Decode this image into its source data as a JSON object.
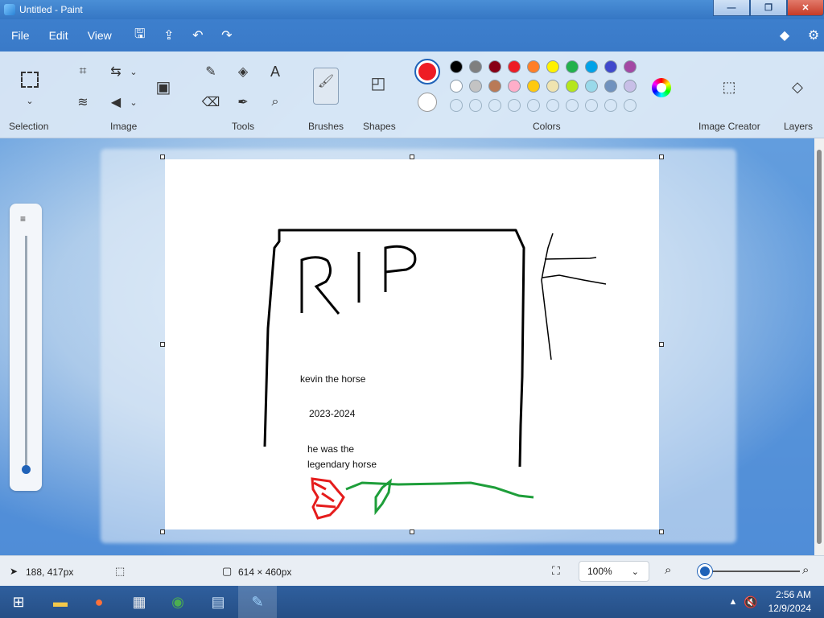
{
  "window": {
    "title": "Untitled - Paint",
    "minimize": "—",
    "maximize": "❐",
    "close": "✕"
  },
  "menu": {
    "items": [
      "File",
      "Edit",
      "View"
    ]
  },
  "ribbon": {
    "groups": {
      "selection": "Selection",
      "image": "Image",
      "tools": "Tools",
      "brushes": "Brushes",
      "shapes": "Shapes",
      "colors": "Colors",
      "image_creator": "Image Creator",
      "layers": "Layers"
    },
    "primary_color": "#ee1c24",
    "secondary_color": "#ffffff",
    "palette_row1": [
      "#000000",
      "#7f7f7f",
      "#880015",
      "#ed1c24",
      "#ff7f27",
      "#fff200",
      "#22b14c",
      "#00a2e8",
      "#3f48cc",
      "#a349a4"
    ],
    "palette_row2": [
      "#ffffff",
      "#c3c3c3",
      "#b97a57",
      "#ffaec9",
      "#ffc90e",
      "#efe4b0",
      "#b5e61d",
      "#99d9ea",
      "#7092be",
      "#c8bfe7"
    ]
  },
  "canvas": {
    "texts": {
      "rip": "RIP",
      "name": "kevin the horse",
      "years": "2023-2024",
      "epitaph_line1": "he was the",
      "epitaph_line2": "legendary horse"
    }
  },
  "status": {
    "cursor": "188, 417px",
    "canvas_size": "614 × 460px",
    "zoom": "100%"
  },
  "taskbar": {
    "time": "2:56 AM",
    "date": "12/9/2024"
  }
}
